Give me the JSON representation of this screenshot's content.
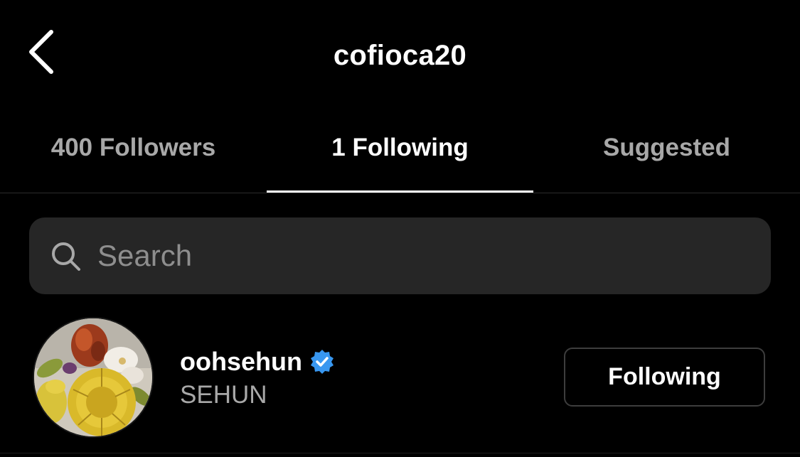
{
  "header": {
    "title": "cofioca20",
    "back_icon": "chevron-left-icon"
  },
  "tabs": [
    {
      "label": "400 Followers",
      "active": false
    },
    {
      "label": "1 Following",
      "active": true
    },
    {
      "label": "Suggested",
      "active": false
    }
  ],
  "search": {
    "placeholder": "Search",
    "value": "",
    "icon": "search-icon"
  },
  "following_list": [
    {
      "username": "oohsehun",
      "verified": true,
      "full_name": "SEHUN",
      "button_label": "Following"
    }
  ],
  "colors": {
    "background": "#000000",
    "text_primary": "#ffffff",
    "text_secondary": "#a8a8a8",
    "search_bg": "#262626",
    "verified_badge": "#3897f0",
    "button_border": "#3d3d3d"
  }
}
